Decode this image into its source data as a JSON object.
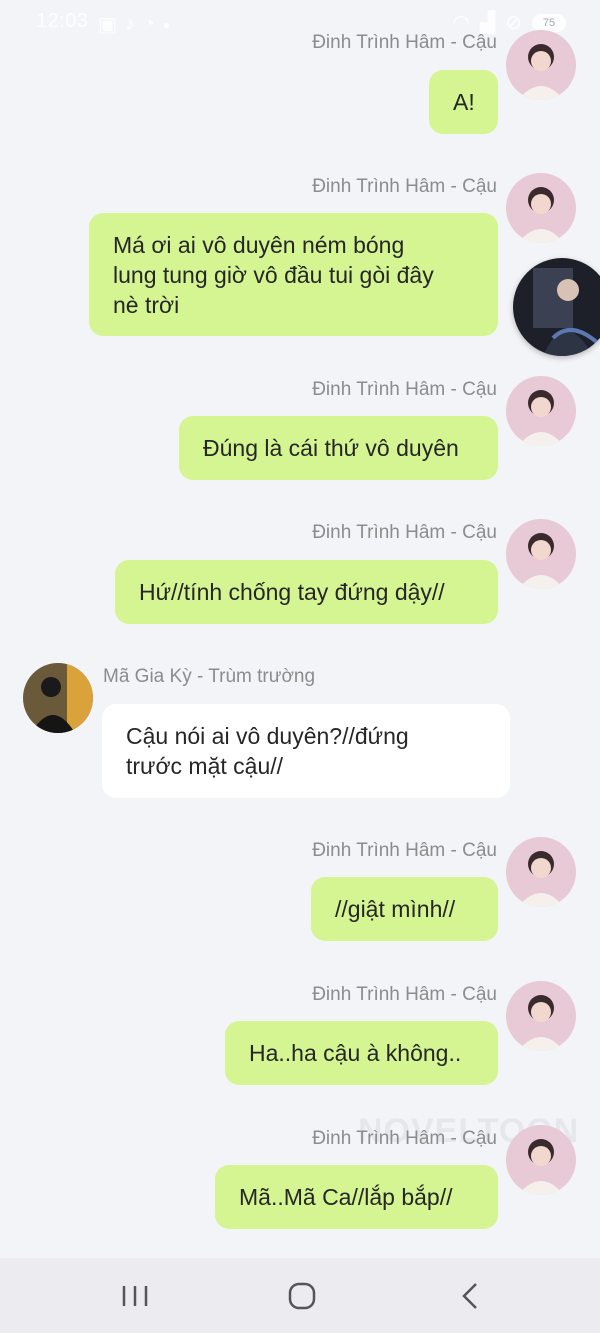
{
  "status_bar": {
    "time": "12:03",
    "battery": "75"
  },
  "colors": {
    "outgoing_bubble": "#d5f592",
    "incoming_bubble": "#ffffff",
    "background": "#f3f4f8",
    "sender_text": "#8c8c8c"
  },
  "messages": [
    {
      "side": "right",
      "sender": "Đinh Trình Hâm - Cậu",
      "text": "A!"
    },
    {
      "side": "right",
      "sender": "Đinh Trình Hâm - Cậu",
      "text_lines": [
        "Má ơi ai vô duyên ném bóng",
        "lung tung giờ vô đầu tui gòi đây",
        "nè trời"
      ]
    },
    {
      "side": "right",
      "sender": "Đinh Trình Hâm - Cậu",
      "text": "Đúng là cái thứ vô duyên"
    },
    {
      "side": "right",
      "sender": "Đinh Trình Hâm - Cậu",
      "text": "Hứ//tính chống tay đứng dậy//"
    },
    {
      "side": "left",
      "sender": "Mã Gia Kỳ - Trùm trường",
      "text_lines": [
        "Cậu nói ai vô duyên?//đứng",
        "trước mặt cậu//"
      ]
    },
    {
      "side": "right",
      "sender": "Đinh Trình Hâm - Cậu",
      "text": "//giật mình//"
    },
    {
      "side": "right",
      "sender": "Đinh Trình Hâm - Cậu",
      "text": "Ha..ha cậu à không.."
    },
    {
      "side": "right",
      "sender": "Đinh Trình Hâm - Cậu",
      "text": "Mã..Mã Ca//lắp bắp//"
    }
  ],
  "watermark": "NOVELTOON",
  "navbar": {
    "icons": [
      "recent-apps-icon",
      "home-icon",
      "back-icon"
    ]
  }
}
